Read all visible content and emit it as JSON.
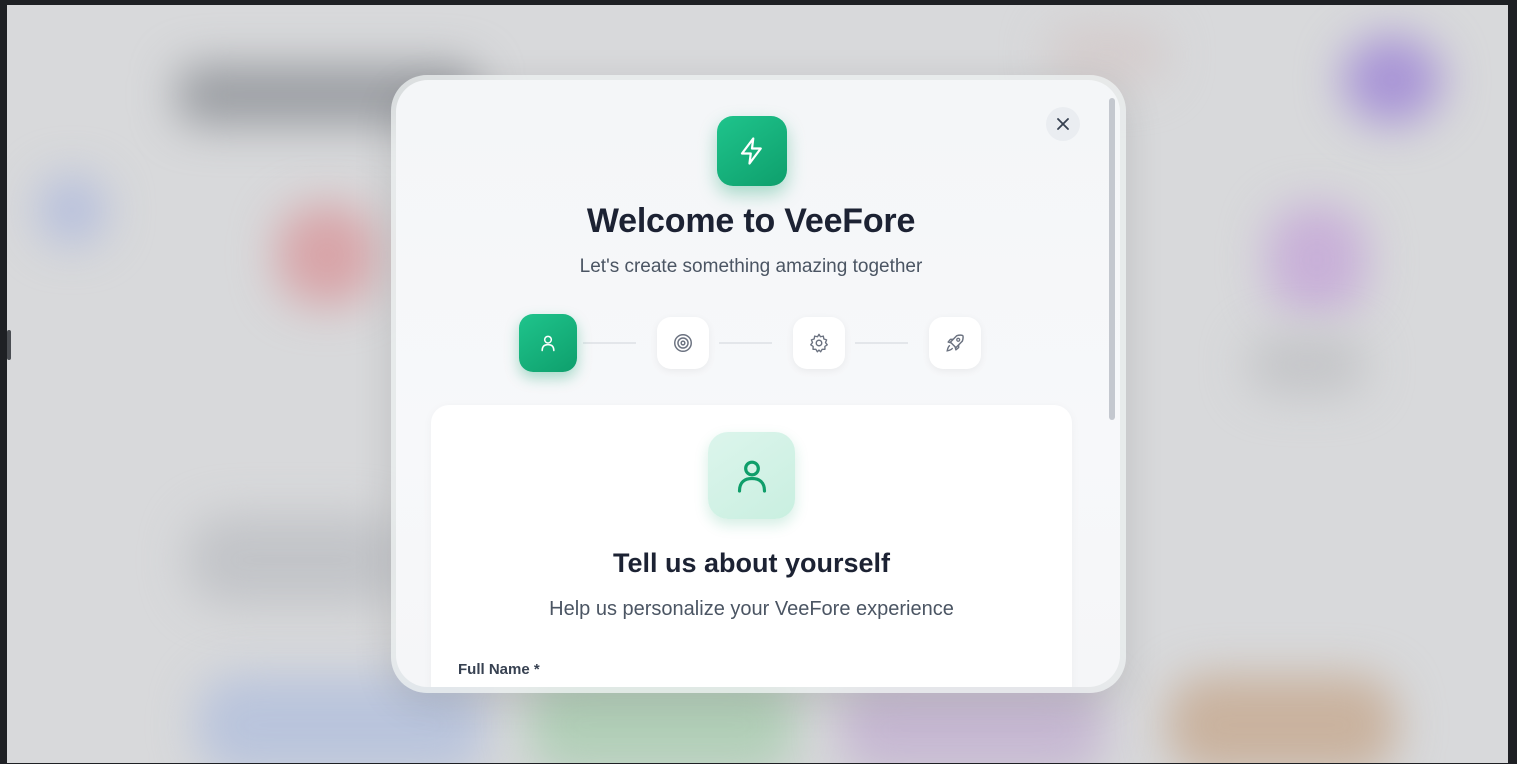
{
  "modal": {
    "close_label": "×",
    "title": "Welcome to VeeFore",
    "subtitle": "Let's create something amazing together",
    "steps": [
      {
        "icon": "user-icon",
        "state": "active"
      },
      {
        "icon": "target-icon",
        "state": "inactive"
      },
      {
        "icon": "gear-icon",
        "state": "inactive"
      },
      {
        "icon": "rocket-icon",
        "state": "inactive"
      }
    ],
    "card": {
      "icon": "user-icon",
      "title": "Tell us about yourself",
      "subtitle": "Help us personalize your VeeFore experience",
      "field_label": "Full Name *"
    }
  },
  "colors": {
    "accent": "#10a36e",
    "accent_light": "#d4f3e7",
    "text_primary": "#1c2233",
    "text_secondary": "#4b5563"
  }
}
